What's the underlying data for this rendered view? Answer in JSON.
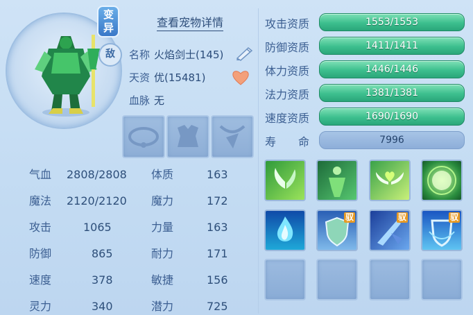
{
  "pet": {
    "variant_badge": "变异",
    "sub_badge": "敌",
    "detail_link": "查看宠物详情",
    "name_label": "名称",
    "name_value": "火焰剑士(145)",
    "talent_label": "天资",
    "talent_value": "优(15481)",
    "bloodline_label": "血脉",
    "bloodline_value": "无"
  },
  "stats": [
    {
      "label": "气血",
      "value": "2808/2808"
    },
    {
      "label": "魔法",
      "value": "2120/2120"
    },
    {
      "label": "攻击",
      "value": "1065"
    },
    {
      "label": "防御",
      "value": "865"
    },
    {
      "label": "速度",
      "value": "378"
    },
    {
      "label": "灵力",
      "value": "340"
    }
  ],
  "attributes": [
    {
      "label": "体质",
      "value": "163"
    },
    {
      "label": "魔力",
      "value": "172"
    },
    {
      "label": "力量",
      "value": "163"
    },
    {
      "label": "耐力",
      "value": "171"
    },
    {
      "label": "敏捷",
      "value": "156"
    },
    {
      "label": "潜力",
      "value": "725"
    }
  ],
  "aptitudes": [
    {
      "label": "攻击资质",
      "value": "1553/1553",
      "fill": 1.0
    },
    {
      "label": "防御资质",
      "value": "1411/1411",
      "fill": 1.0
    },
    {
      "label": "体力资质",
      "value": "1446/1446",
      "fill": 1.0
    },
    {
      "label": "法力资质",
      "value": "1381/1381",
      "fill": 1.0
    },
    {
      "label": "速度资质",
      "value": "1690/1690",
      "fill": 1.0
    }
  ],
  "life": {
    "label": "寿　　命",
    "value": "7996"
  },
  "skills": [
    {
      "icon": "wings-icon",
      "tag": ""
    },
    {
      "icon": "figure-aura-icon",
      "tag": ""
    },
    {
      "icon": "heart-wings-icon",
      "tag": ""
    },
    {
      "icon": "green-orb-icon",
      "tag": ""
    },
    {
      "icon": "blue-flame-icon",
      "tag": ""
    },
    {
      "icon": "shield-icon",
      "tag": "驭"
    },
    {
      "icon": "crystal-blade-icon",
      "tag": "驭"
    },
    {
      "icon": "barrier-icon",
      "tag": "驭"
    }
  ],
  "colors": {
    "aptitude_bar": "#3dbf8e",
    "skill_tag": "#e79a25",
    "background": "#cfe3f6"
  }
}
